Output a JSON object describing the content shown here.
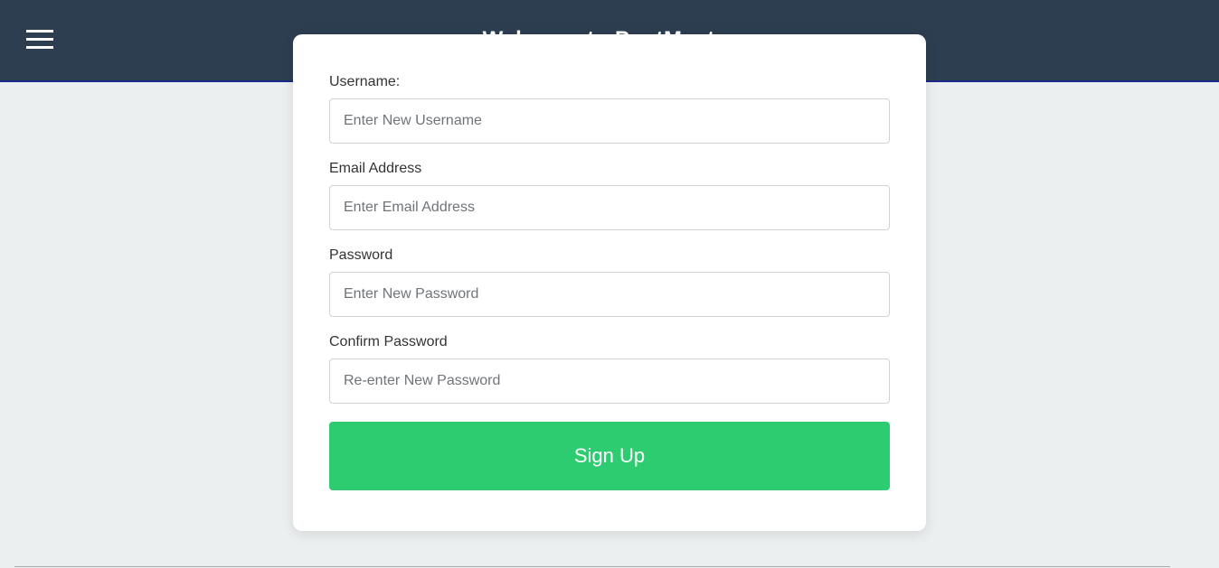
{
  "header": {
    "title": "Welcome to PostMaster",
    "menu_icon": "hamburger-menu-icon",
    "background_color": "#2c3e50"
  },
  "form": {
    "username": {
      "label": "Username:",
      "placeholder": "Enter New Username",
      "value": ""
    },
    "email": {
      "label": "Email Address",
      "placeholder": "Enter Email Address",
      "value": ""
    },
    "password": {
      "label": "Password",
      "placeholder": "Enter New Password",
      "value": ""
    },
    "confirm_password": {
      "label": "Confirm Password",
      "placeholder": "Re-enter New Password",
      "value": ""
    },
    "submit_label": "Sign Up",
    "submit_color": "#2ecc71"
  }
}
